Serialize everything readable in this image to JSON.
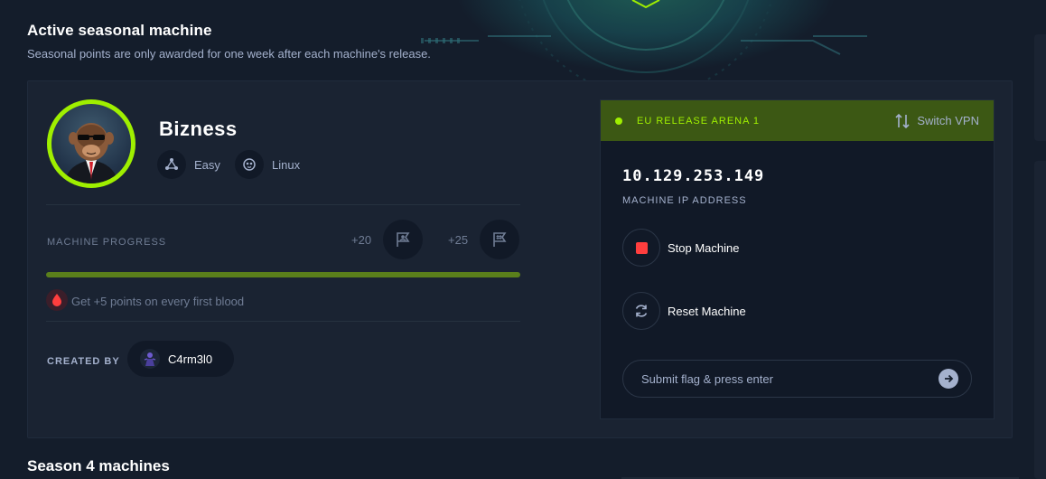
{
  "section": {
    "title": "Active seasonal machine",
    "subtitle": "Seasonal points are only awarded for one week after each machine's release."
  },
  "machine": {
    "name": "Bizness",
    "difficulty": "Easy",
    "os": "Linux",
    "progress_label": "MACHINE PROGRESS",
    "user_points": "+20",
    "root_points": "+25",
    "progress_fraction": 1.0,
    "first_blood_text": "Get +5 points on every first blood",
    "created_by_label": "CREATED BY",
    "creator": "C4rm3l0"
  },
  "panel": {
    "arena": "EU RELEASE ARENA 1",
    "switch_vpn": "Switch VPN",
    "ip": "10.129.253.149",
    "ip_label": "MACHINE IP ADDRESS",
    "stop": "Stop Machine",
    "reset": "Reset Machine",
    "flag_placeholder": "Submit flag & press enter"
  },
  "next_section": {
    "title": "Season 4 machines"
  },
  "colors": {
    "accent": "#9fef00",
    "background": "#141d2b",
    "card": "#1a2332",
    "panel_header": "#3c5814",
    "stop_red": "#ff3e3e"
  }
}
